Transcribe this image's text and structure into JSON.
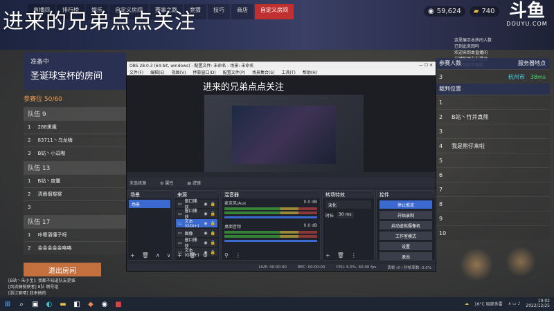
{
  "overlay_title": "进来的兄弟点点关注",
  "top_nav": [
    "直播间",
    "排行榜",
    "娱乐",
    "自定义房间",
    "赛事之路",
    "竞猜",
    "技巧",
    "商店",
    "自定义房间"
  ],
  "top_nav_active": 8,
  "stats": {
    "coins": "59,624",
    "gold": "740"
  },
  "brand": {
    "logo": "斗鱼",
    "url": "DOUYU.COM"
  },
  "right_notes": [
    "这里展示本房间人数",
    "已到此来回吗",
    "欢迎来到本直播间",
    "左键拖拽左右滑动",
    "点赞后即可抽奖"
  ],
  "left_panel": {
    "status": "准备中",
    "room_name": "圣诞球宝杯的房间",
    "seats_label": "参赛位",
    "seats": "50/60",
    "teams": [
      {
        "name": "队伍 9",
        "rows": [
          {
            "n": "1",
            "p": "288熏鹰"
          },
          {
            "n": "2",
            "p": "83711丶乌龙嗨"
          },
          {
            "n": "3",
            "p": "B站丶小逗嗷"
          }
        ]
      },
      {
        "name": "队伍 13",
        "rows": [
          {
            "n": "1",
            "p": "B站丶度囊"
          },
          {
            "n": "2",
            "p": "清晨烟棍棠"
          },
          {
            "n": "3",
            "p": ""
          }
        ]
      },
      {
        "name": "队伍 17",
        "rows": [
          {
            "n": "1",
            "p": "咔嚓酒懂子呀"
          },
          {
            "n": "2",
            "p": "金金金金金咯咯"
          }
        ]
      }
    ],
    "exit_button": "退出房间"
  },
  "chat": [
    "[B站丶朱小宝]: 我都不知道队友是谁",
    "[风流倜傥使者] 8队 啊号组",
    "[浙江丽晴] 我来搞的"
  ],
  "right_panel": {
    "col_players": "参赛人数",
    "col_server": "服务器地点",
    "server": "杭州市",
    "ping": "38ms",
    "judges_label": "裁判位置",
    "rows": [
      {
        "n": "1",
        "p": ""
      },
      {
        "n": "2",
        "p": "B站丶竹井真熊"
      },
      {
        "n": "3",
        "p": ""
      },
      {
        "n": "4",
        "p": "我是熊仔来啦"
      },
      {
        "n": "5",
        "p": ""
      },
      {
        "n": "6",
        "p": ""
      },
      {
        "n": "7",
        "p": ""
      },
      {
        "n": "8",
        "p": ""
      },
      {
        "n": "9",
        "p": ""
      },
      {
        "n": "10",
        "p": ""
      }
    ]
  },
  "obs": {
    "title": "OBS 28.0.3 (64-bit, windows) - 配置文件: 未命名 - 场景: 未命名",
    "menu": [
      "文件(F)",
      "编辑(E)",
      "视图(V)",
      "停靠窗口(D)",
      "配置文件(P)",
      "场景集合(S)",
      "工具(T)",
      "帮助(H)"
    ],
    "nested_title": "进来的兄弟点点关注",
    "no_source": "未选择源",
    "props_label": "属性",
    "filter_label": "滤镜",
    "docks": {
      "scenes": "场景",
      "sources": "来源",
      "mixer": "混音器",
      "transitions": "转场特效",
      "controls": "控件"
    },
    "scene_item": "场景",
    "sources": [
      "窗口捕获",
      "窗口捕获",
      "文本(GDI+)",
      "图像",
      "窗口捕获",
      "文本(GDI+)"
    ],
    "mixer": [
      {
        "name": "麦克风/Aux",
        "db": "0.0 dB"
      },
      {
        "name": "桌面音频",
        "db": "0.0 dB"
      }
    ],
    "transition_type": "淡化",
    "duration_label": "时长",
    "duration": "30 ms",
    "controls": [
      "停止推流",
      "开始录制",
      "启动虚拟摄像机",
      "工作室模式",
      "设置",
      "退出"
    ],
    "status": {
      "live": "LIVE: 00:00:00",
      "rec": "REC: 00:00:00",
      "cpu": "CPU: 6.5%, 60.00 fps",
      "dropped": "丢帧 (0 ) 秒帧率数: 0.0%"
    }
  },
  "taskbar": {
    "weather": "16°C 局部多雷",
    "time": "19:02",
    "date": "2022/12/25"
  }
}
